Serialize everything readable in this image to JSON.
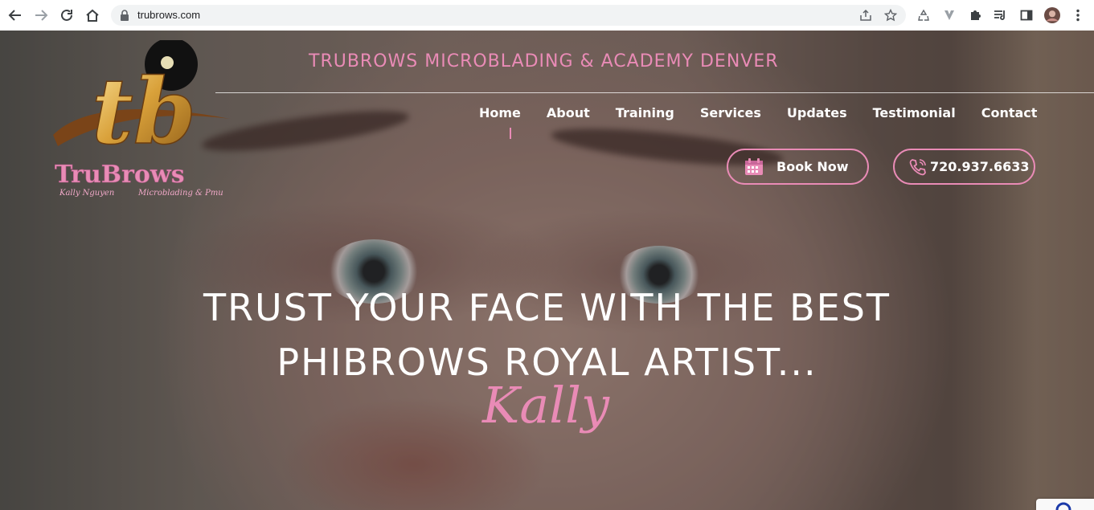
{
  "browser": {
    "url": "trubrows.com"
  },
  "site": {
    "tagline": "TRUBROWS MICROBLADING & ACADEMY DENVER",
    "logo": {
      "text": "TruBrows",
      "subtext_left": "Kally Nguyen",
      "subtext_right": "Microblading & Pmu"
    },
    "menu": [
      {
        "label": "Home",
        "active": true
      },
      {
        "label": "About"
      },
      {
        "label": "Training"
      },
      {
        "label": "Services"
      },
      {
        "label": "Updates"
      },
      {
        "label": "Testimonial"
      },
      {
        "label": "Contact"
      }
    ],
    "book_label": "Book Now",
    "phone_label": "720.937.6633",
    "hero_line1": "TRUST YOUR FACE WITH THE BEST",
    "hero_line2": "PHIBROWS ROYAL ARTIST...",
    "signature": "Kally",
    "accent_color": "#e98bb6"
  }
}
